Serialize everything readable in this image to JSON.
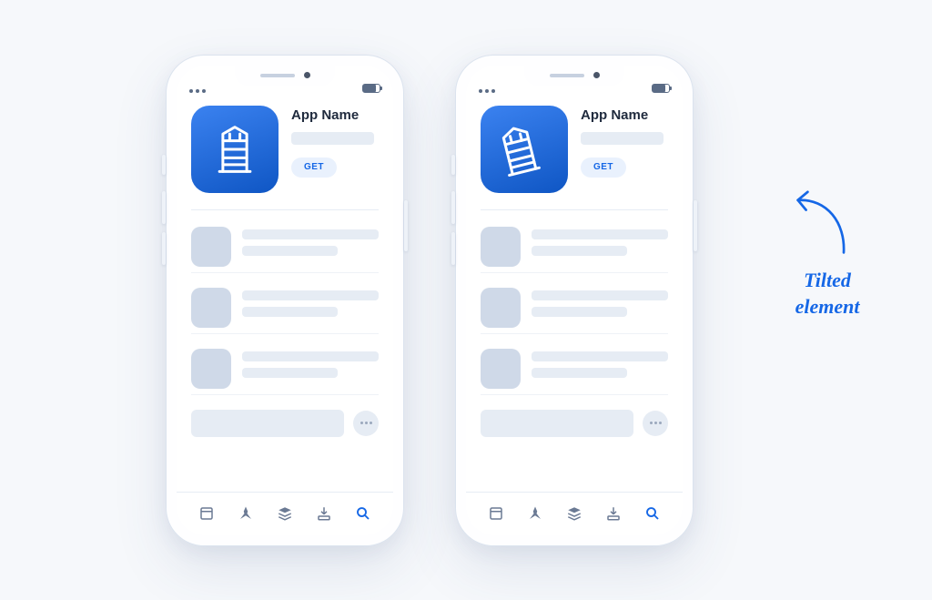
{
  "phones": [
    {
      "app_name": "App Name",
      "get_label": "GET",
      "icon_tilted": false
    },
    {
      "app_name": "App Name",
      "get_label": "GET",
      "icon_tilted": true
    }
  ],
  "annotation": {
    "line1": "Tilted",
    "line2": "element"
  },
  "colors": {
    "accent": "#1567e6",
    "icon_gradient_start": "#3b82f0",
    "icon_gradient_end": "#0f56c4",
    "placeholder": "#e6ecf4"
  },
  "tabs": [
    "today-icon",
    "rocket-icon",
    "layers-icon",
    "download-icon",
    "search-icon"
  ]
}
